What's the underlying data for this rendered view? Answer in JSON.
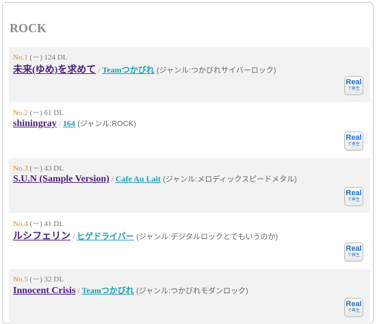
{
  "category": {
    "heading": "ROCK"
  },
  "rows": [
    {
      "rank": "No.1",
      "stats": "(－) 124 DL",
      "title": "未来(ゆめ)を求めて",
      "separator": "/",
      "artist": "Teamつかびれ",
      "genre": "(ジャンル:つかびれサイバーロック)",
      "btn_main": "Real",
      "btn_sub": "で再生"
    },
    {
      "rank": "No.2",
      "stats": "(－) 61 DL",
      "title": "shiningray",
      "separator": "/",
      "artist": "164",
      "genre": "(ジャンル:ROCK)",
      "btn_main": "Real",
      "btn_sub": "で再生"
    },
    {
      "rank": "No.3",
      "stats": "(－) 43 DL",
      "title": "S.U.N (Sample Version)",
      "separator": "/",
      "artist": "Cafe Au Lait",
      "genre": "(ジャンル:メロディックスピードメタル)",
      "btn_main": "Real",
      "btn_sub": "で再生"
    },
    {
      "rank": "No.4",
      "stats": "(－) 41 DL",
      "title": "ルシフェリン",
      "separator": "/",
      "artist": "ヒゲドライバー",
      "genre": "(ジャンル:デジタルロックとでもいうのか)",
      "btn_main": "Real",
      "btn_sub": "で再生"
    },
    {
      "rank": "No.5",
      "stats": "(－) 32 DL",
      "title": "Innocent Crisis",
      "separator": "/",
      "artist": "Teamつかびれ",
      "genre": "(ジャンル:つかびれモダンロック)",
      "btn_main": "Real",
      "btn_sub": "で再生"
    }
  ]
}
